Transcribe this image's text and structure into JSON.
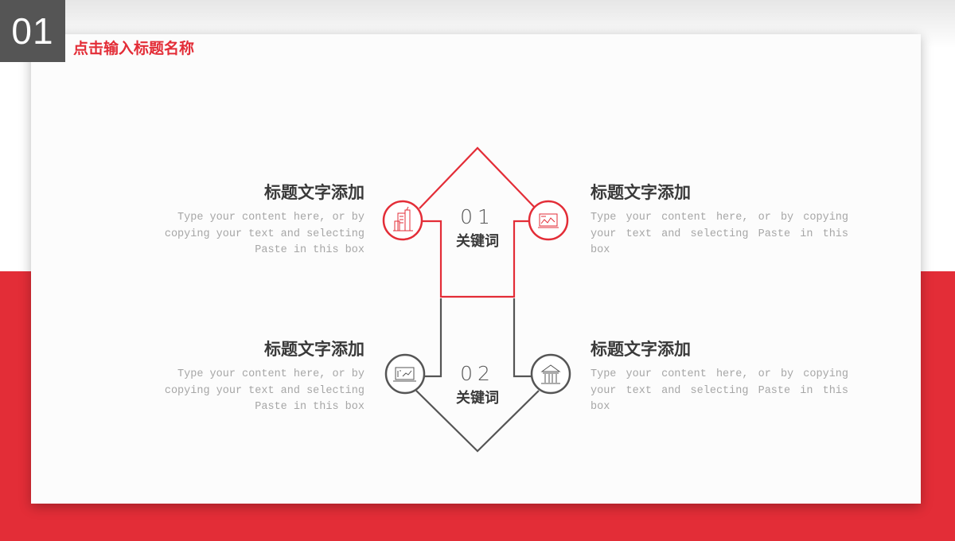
{
  "header": {
    "section_number": "01",
    "title": "点击输入标题名称"
  },
  "colors": {
    "accent": "#e32d37",
    "dark": "#555555",
    "text_heading": "#3a3a3a",
    "text_body": "#a6a6a6"
  },
  "arrows": [
    {
      "number": "01",
      "keyword": "关键词",
      "color": "#e32d37",
      "direction": "up"
    },
    {
      "number": "02",
      "keyword": "关键词",
      "color": "#555555",
      "direction": "down"
    }
  ],
  "items": [
    {
      "title": "标题文字添加",
      "body": "Type your content here, or by copying your text and selecting Paste in this box",
      "icon": "buildings-icon",
      "position": "top-left"
    },
    {
      "title": "标题文字添加",
      "body": "Type your content here, or by copying your text and selecting Paste in this box",
      "icon": "chart-monitor-icon",
      "position": "top-right"
    },
    {
      "title": "标题文字添加",
      "body": "Type your content here, or by copying your text and selecting Paste in this box",
      "icon": "laptop-chart-icon",
      "position": "bottom-left"
    },
    {
      "title": "标题文字添加",
      "body": "Type your content here, or by copying your text and selecting Paste in this box",
      "icon": "bank-icon",
      "position": "bottom-right"
    }
  ]
}
